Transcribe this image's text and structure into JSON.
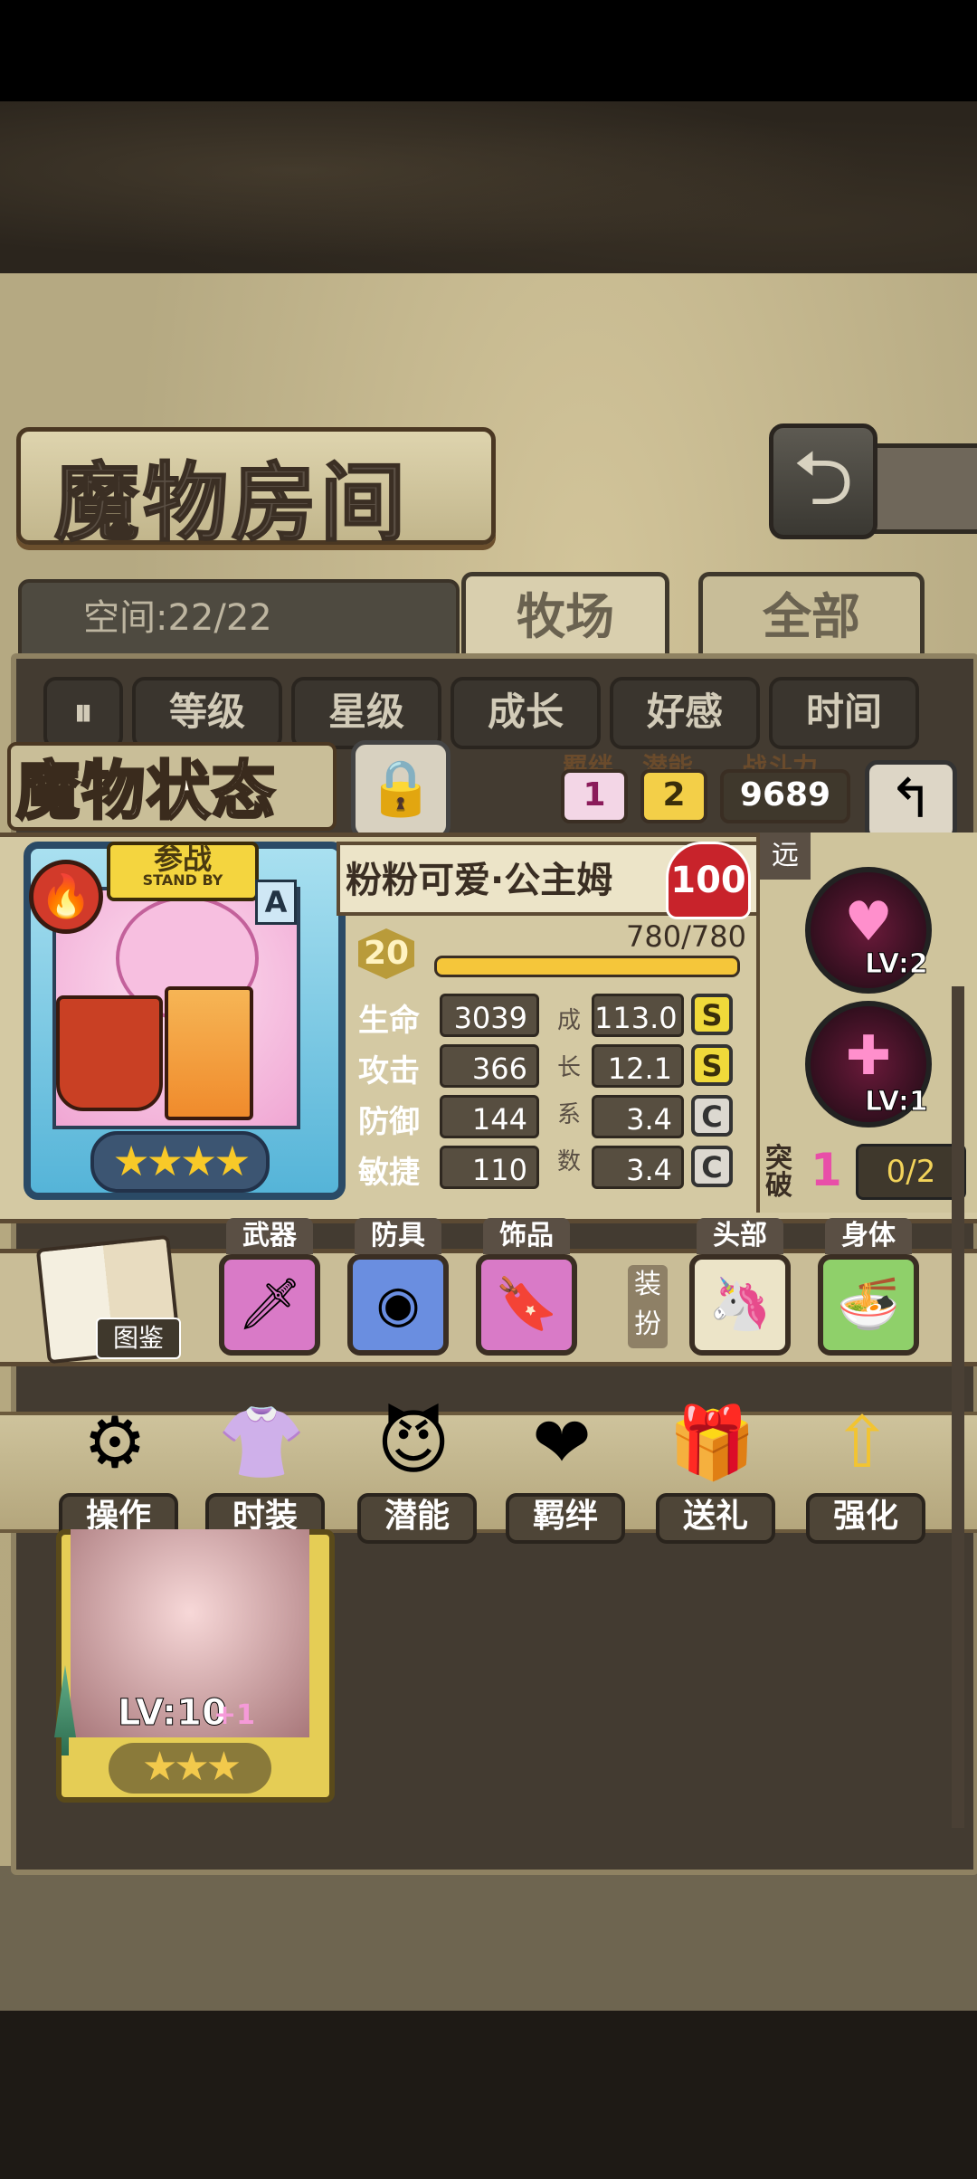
{
  "header": {
    "title": "魔物房间",
    "back_icon": "back-arrow-icon"
  },
  "tabs": {
    "space_label": "空间:22/22",
    "ranch": "牧场",
    "all": "全部"
  },
  "sort": {
    "toggle_icon": "pause-toggle-icon",
    "buttons": [
      "等级",
      "星级",
      "成长",
      "好感",
      "时间"
    ]
  },
  "status": {
    "title": "魔物状态",
    "bond_label": "羁绊",
    "bond_value": "1",
    "potential_label": "潜能",
    "potential_value": "2",
    "power_label": "战斗力",
    "power_value": "9689"
  },
  "card": {
    "standby_cn": "参战",
    "standby_en": "STAND BY",
    "rank": "A",
    "stars": "★★★★"
  },
  "monster": {
    "name": "粉粉可爱·公主姆",
    "affection": "100",
    "level": "20",
    "xp": "780/780"
  },
  "stats": [
    {
      "name": "生命",
      "value": "3039",
      "growth": "113.0",
      "grade": "S"
    },
    {
      "name": "攻击",
      "value": "366",
      "growth": "12.1",
      "grade": "S"
    },
    {
      "name": "防御",
      "value": "144",
      "growth": "3.4",
      "grade": "C"
    },
    {
      "name": "敏捷",
      "value": "110",
      "growth": "3.4",
      "grade": "C"
    }
  ],
  "growth_label": [
    "成",
    "长",
    "系",
    "数"
  ],
  "skills": {
    "range": "远",
    "skill1_lv": "LV:2",
    "skill2_lv": "LV:1",
    "break_label": "突破",
    "break_value": "1",
    "break_progress": "0/2"
  },
  "equip": {
    "book_label": "图鉴",
    "weapon": "武器",
    "armor": "防具",
    "accessory": "饰品",
    "dress_label": "装扮",
    "head": "头部",
    "body": "身体"
  },
  "functions": [
    {
      "label": "操作",
      "icon": "gear-icon"
    },
    {
      "label": "时装",
      "icon": "outfit-icon"
    },
    {
      "label": "潜能",
      "icon": "demon-icon"
    },
    {
      "label": "羁绊",
      "icon": "hearts-icon"
    },
    {
      "label": "送礼",
      "icon": "gift-icon"
    },
    {
      "label": "强化",
      "icon": "up-arrows-icon"
    }
  ],
  "list_monster": {
    "level": "LV:10",
    "bonus": "+1",
    "stars": "★★★"
  }
}
